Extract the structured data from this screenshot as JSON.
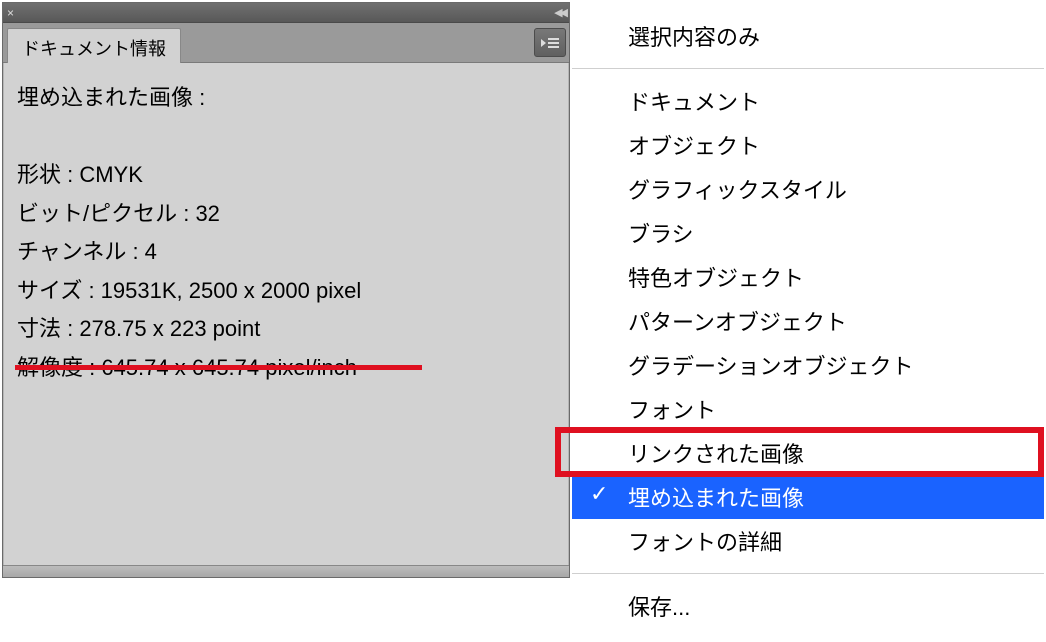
{
  "panel": {
    "tab_title": "ドキュメント情報",
    "lines": {
      "header": "埋め込まれた画像 :",
      "shape": "形状 : CMYK",
      "bits": "ビット/ピクセル : 32",
      "channels": "チャンネル : 4",
      "size": "サイズ : 19531K, 2500 x 2000 pixel",
      "dims": "寸法 : 278.75 x 223 point",
      "res": "解像度 : 645.74 x 645.74 pixel/inch"
    }
  },
  "menu": {
    "selection_only": "選択内容のみ",
    "items": [
      "ドキュメント",
      "オブジェクト",
      "グラフィックスタイル",
      "ブラシ",
      "特色オブジェクト",
      "パターンオブジェクト",
      "グラデーションオブジェクト",
      "フォント",
      "リンクされた画像",
      "埋め込まれた画像",
      "フォントの詳細"
    ],
    "save": "保存...",
    "checkmark": "✓"
  }
}
